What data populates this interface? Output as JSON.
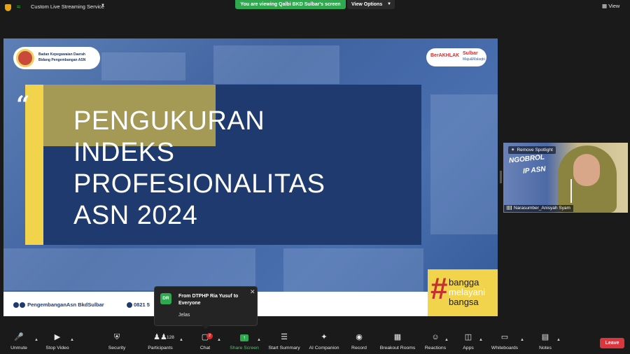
{
  "top_bar": {
    "stream_label": "Custom Live Streaming Service",
    "viewing_banner": "You are viewing Qalbi BKD Sulbar's screen",
    "view_options": "View Options",
    "view": "View"
  },
  "slide": {
    "org_line1": "Badan Kepegawaian Daerah",
    "org_line2": "Bidang Pengembangan ASN",
    "berakhlak": "BerAKHLAK",
    "sulbar": "Sulbar",
    "sulbar_sub": "Maju&Malaqbi",
    "title_lines": [
      "PENGUKURAN",
      "INDEKS",
      "PROFESIONALITAS",
      "ASN 2024"
    ],
    "social_handle": "PengembanganAsn BkdSulbar",
    "phone": "0821 5",
    "hashtag_line1": "bangga",
    "hashtag_line2": "melayani",
    "hashtag_line3": "bangsa"
  },
  "video": {
    "remove_spotlight": "Remove Spotlight",
    "participant_name": "Narasumber_Anisyah Syam",
    "bg_text1": "NGOBROL",
    "bg_text2": "IP ASN"
  },
  "chat_popup": {
    "avatar_initials": "DR",
    "from": "From DTPHP Ria Yusuf to Everyone",
    "message": "Jelas"
  },
  "toolbar": {
    "unmute": "Unmute",
    "stop_video": "Stop Video",
    "security": "Security",
    "participants": "Participants",
    "participant_count": "128",
    "chat": "Chat",
    "chat_badge": "2",
    "share_screen": "Share Screen",
    "start_summary": "Start Summary",
    "ai_companion": "AI Companion",
    "record": "Record",
    "breakout_rooms": "Breakout Rooms",
    "reactions": "Reactions",
    "apps": "Apps",
    "whiteboards": "Whiteboards",
    "notes": "Notes",
    "leave": "Leave"
  },
  "colors": {
    "zoom_green": "#2fa84f",
    "leave_red": "#d9363e",
    "slide_navy": "#1f3a6e",
    "slide_yellow": "#f2d34c",
    "slide_olive": "#a59956"
  }
}
